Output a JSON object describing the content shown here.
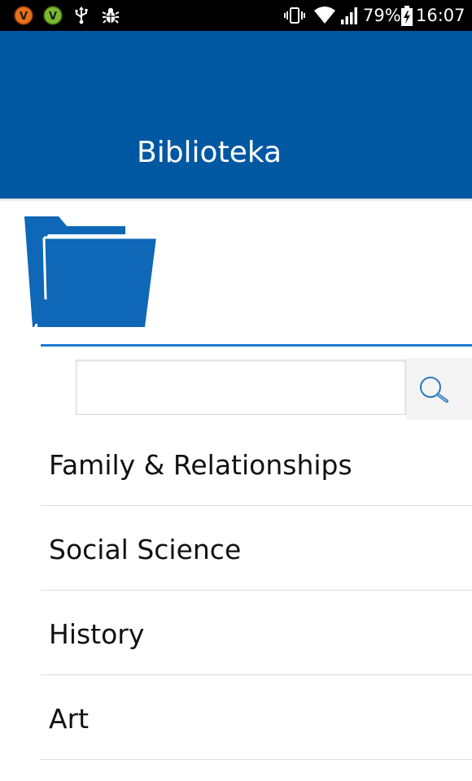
{
  "status_bar": {
    "notification_icons": [
      "vlc-icon",
      "v-app-icon",
      "usb-icon",
      "debug-icon"
    ],
    "system_icons": [
      "vibrate-icon",
      "wifi-icon",
      "signal-icon",
      "battery-charging-icon"
    ],
    "battery_percent": "79%",
    "time": "16:07"
  },
  "app_bar": {
    "title": "Biblioteka",
    "background_color": "#0058a3"
  },
  "header_icon": "folder-icon",
  "search": {
    "placeholder": "",
    "value": "",
    "button_icon": "search-icon"
  },
  "categories": [
    {
      "label": "Family & Relationships"
    },
    {
      "label": "Social Science"
    },
    {
      "label": "History"
    },
    {
      "label": "Art"
    }
  ],
  "colors": {
    "accent": "#1e7ad1",
    "folder": "#0f67b8",
    "text": "#111111"
  }
}
